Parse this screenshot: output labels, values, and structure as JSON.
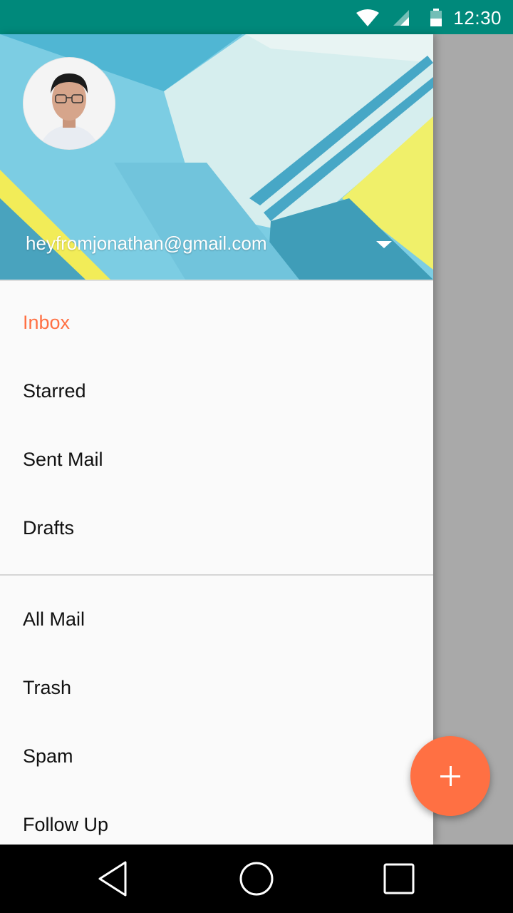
{
  "status_bar": {
    "time": "12:30",
    "icons": [
      "wifi-icon",
      "cellular-signal-icon",
      "battery-icon"
    ]
  },
  "drawer": {
    "account": {
      "email": "heyfromjonathan@gmail.com",
      "dropdown_icon": "arrow-drop-down-icon",
      "avatar_icon": "profile-photo"
    },
    "primary_items": [
      {
        "label": "Inbox",
        "active": true
      },
      {
        "label": "Starred",
        "active": false
      },
      {
        "label": "Sent Mail",
        "active": false
      },
      {
        "label": "Drafts",
        "active": false
      }
    ],
    "secondary_items": [
      {
        "label": "All Mail"
      },
      {
        "label": "Trash"
      },
      {
        "label": "Spam"
      },
      {
        "label": "Follow Up"
      }
    ]
  },
  "fab": {
    "icon": "plus-icon"
  },
  "nav_bar": {
    "icons": [
      "back-icon",
      "home-icon",
      "recents-icon"
    ]
  },
  "colors": {
    "status_bar": "#00897b",
    "accent": "#ff7043",
    "drawer_bg": "#fafafa",
    "scrim": "#ababab"
  }
}
